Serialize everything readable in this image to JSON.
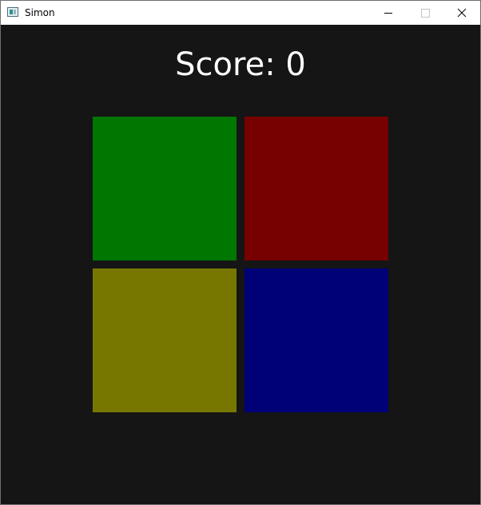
{
  "window": {
    "title": "Simon",
    "icon": "app-window-icon",
    "controls": [
      "minimize-icon",
      "maximize-icon",
      "close-icon"
    ]
  },
  "game": {
    "score_label": "Score: 0",
    "score": 0,
    "pads": [
      {
        "name": "green",
        "color": "#007700"
      },
      {
        "name": "red",
        "color": "#770000"
      },
      {
        "name": "yellow",
        "color": "#777700"
      },
      {
        "name": "blue",
        "color": "#000077"
      }
    ],
    "background": "#151515"
  }
}
